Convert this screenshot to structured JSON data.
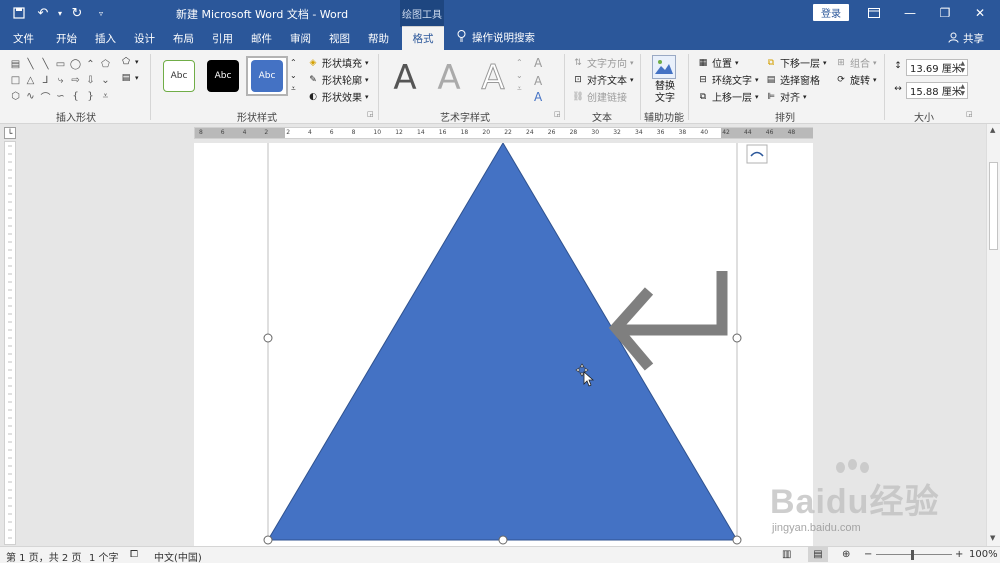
{
  "window": {
    "title": "新建 Microsoft Word 文档 - Word",
    "context_tab": "绘图工具",
    "login": "登录"
  },
  "tabs": [
    "文件",
    "开始",
    "插入",
    "设计",
    "布局",
    "引用",
    "邮件",
    "审阅",
    "视图",
    "帮助"
  ],
  "active_tab": "格式",
  "tell_me": "操作说明搜索",
  "share": "共享",
  "ribbon": {
    "groups": {
      "insert_shapes": "插入形状",
      "shape_styles": "形状样式",
      "wordart": "艺术字样式",
      "text": "文本",
      "accessibility": "辅助功能",
      "arrange": "排列",
      "size": "大小"
    },
    "style_swatches": [
      "Abc",
      "Abc",
      "Abc"
    ],
    "shape_fill": "形状填充",
    "shape_outline": "形状轮廓",
    "shape_effects": "形状效果",
    "wordart_letter": "A",
    "text_direction": "文字方向",
    "align_text": "对齐文本",
    "create_link": "创建链接",
    "alt_text": "替换文字",
    "position": "位置",
    "wrap_text": "环绕文字",
    "bring_forward": "上移一层",
    "send_backward": "下移一层",
    "selection_pane": "选择窗格",
    "align": "对齐",
    "group": "组合",
    "rotate": "旋转",
    "height": "13.69 厘米",
    "width": "15.88 厘米"
  },
  "ruler_numbers": [
    "8",
    "6",
    "4",
    "2",
    "2",
    "4",
    "6",
    "8",
    "10",
    "12",
    "14",
    "16",
    "18",
    "20",
    "22",
    "24",
    "26",
    "28",
    "30",
    "32",
    "34",
    "36",
    "38",
    "40",
    "42",
    "44",
    "46",
    "48"
  ],
  "status": {
    "page": "第 1 页，共 2 页",
    "words": "1 个字",
    "language": "中文(中国)",
    "zoom": "100%"
  },
  "watermark": {
    "brand": "Baidu经验",
    "url": "jingyan.baidu.com"
  },
  "colors": {
    "title_bar": "#2b579a",
    "shape_fill": "#4472c4",
    "arrow": "#7f7f7f"
  }
}
